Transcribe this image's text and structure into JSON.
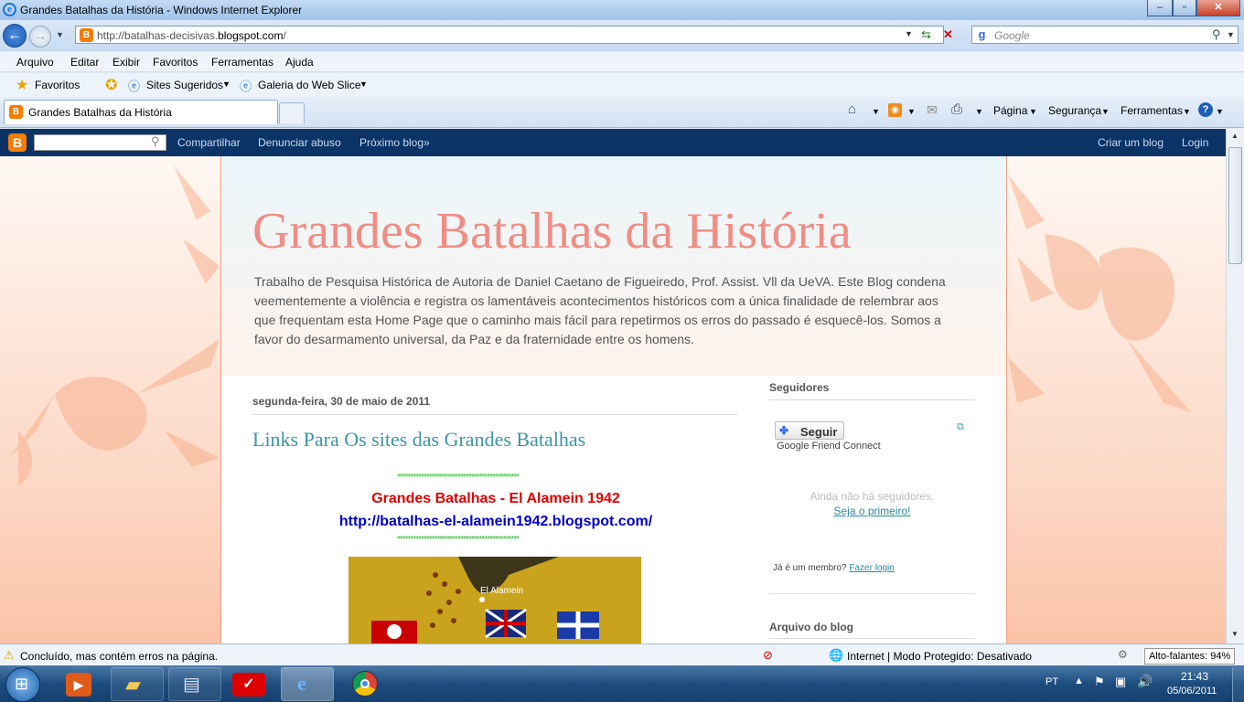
{
  "window": {
    "title": "Grandes Batalhas da História - Windows Internet Explorer"
  },
  "address": {
    "url_prefix": "http://batalhas-decisivas.",
    "url_domain": "blogspot.com",
    "url_suffix": "/",
    "search_placeholder": "Google"
  },
  "menu": [
    "Arquivo",
    "Editar",
    "Exibir",
    "Favoritos",
    "Ferramentas",
    "Ajuda"
  ],
  "favbar": {
    "favorites": "Favoritos",
    "suggested": "Sites Sugeridos",
    "webslice": "Galeria do Web Slice"
  },
  "tab": {
    "label": "Grandes Batalhas da História"
  },
  "cmdbar": {
    "page": "Página",
    "security": "Segurança",
    "tools": "Ferramentas"
  },
  "blogger": {
    "share": "Compartilhar",
    "report": "Denunciar abuso",
    "next": "Próximo blog»",
    "create": "Criar um blog",
    "login": "Login"
  },
  "blog": {
    "title": "Grandes Batalhas da História",
    "description": "Trabalho de Pesquisa Histórica de Autoria de Daniel Caetano de Figueiredo, Prof. Assist. Vll da UeVA. Este Blog condena veementemente a violência e registra os lamentáveis acontecimentos históricos com a única finalidade de relembrar aos que frequentam esta Home Page que o caminho mais fácil para repetirmos os erros do passado é esquecê-los. Somos a favor do desarmamento universal, da Paz e da fraternidade entre os homens."
  },
  "post": {
    "date": "segunda-feira, 30 de maio de 2011",
    "title": "Links Para Os sites das Grandes Batalhas",
    "stars": "**********************************************",
    "heading": "Grandes Batalhas - El Alamein 1942",
    "link": "http://batalhas-el-alamein1942.blogspot.com/",
    "map_label": "El Alamein"
  },
  "sidebar": {
    "followers_title": "Seguidores",
    "follow_button": "Seguir",
    "gfc": "Google Friend Connect",
    "no_followers": "Ainda não há seguidores.",
    "be_first": "Seja o primeiro!",
    "member": "Já é um membro?",
    "login": "Fazer login",
    "archive_title": "Arquivo do blog"
  },
  "status": {
    "text": "Concluído, mas contém erros na página.",
    "zone": "Internet | Modo Protegido: Desativado",
    "tooltip": "Alto-falantes: 94%"
  },
  "tray": {
    "lang": "PT",
    "time": "21:43",
    "date": "05/06/2011"
  }
}
